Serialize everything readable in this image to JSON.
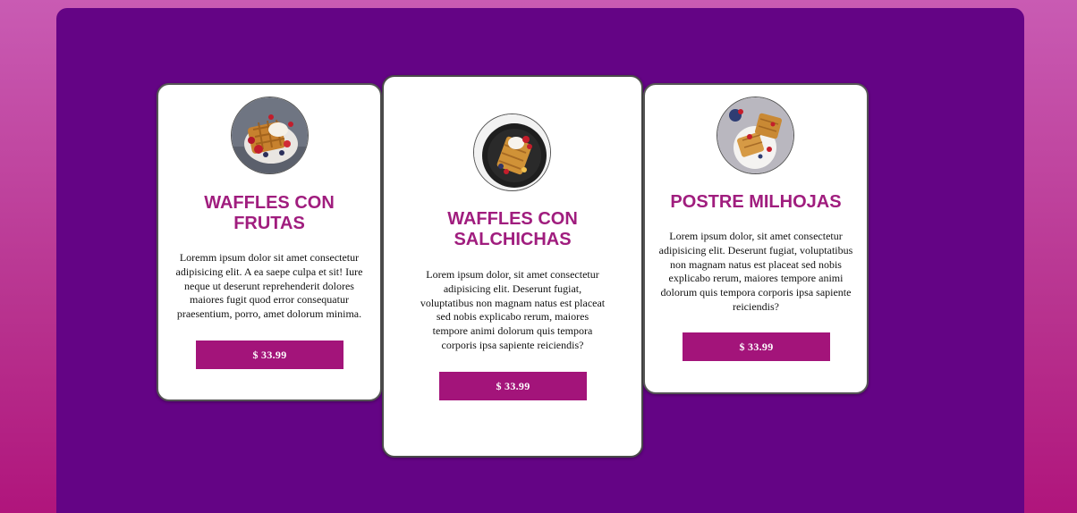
{
  "cards": [
    {
      "title": "WAFFLES CON FRUTAS",
      "description": "Loremm ipsum dolor sit amet consectetur adipisicing elit. A ea saepe culpa et sit! Iure neque ut deserunt reprehenderit dolores maiores fugit quod error consequatur praesentium, porro, amet dolorum minima.",
      "price": "$ 33.99",
      "image": "waffles-fruit-photo"
    },
    {
      "title": "WAFFLES CON SALCHICHAS",
      "description": "Lorem ipsum dolor, sit amet consectetur adipisicing elit. Deserunt fugiat, voluptatibus non magnam natus est placeat sed nobis explicabo rerum, maiores tempore animi dolorum quis tempora corporis ipsa sapiente reiciendis?",
      "price": "$ 33.99",
      "image": "waffles-sausage-photo"
    },
    {
      "title": "POSTRE MILHOJAS",
      "description": "Lorem ipsum dolor, sit amet consectetur adipisicing elit. Deserunt fugiat, voluptatibus non magnam natus est placeat sed nobis explicabo rerum, maiores tempore animi dolorum quis tempora corporis ipsa sapiente reiciendis?",
      "price": "$ 33.99",
      "image": "milhojas-dessert-photo"
    }
  ],
  "colors": {
    "panel": "#640485",
    "accent": "#a3147a",
    "title": "#a01d7e"
  }
}
